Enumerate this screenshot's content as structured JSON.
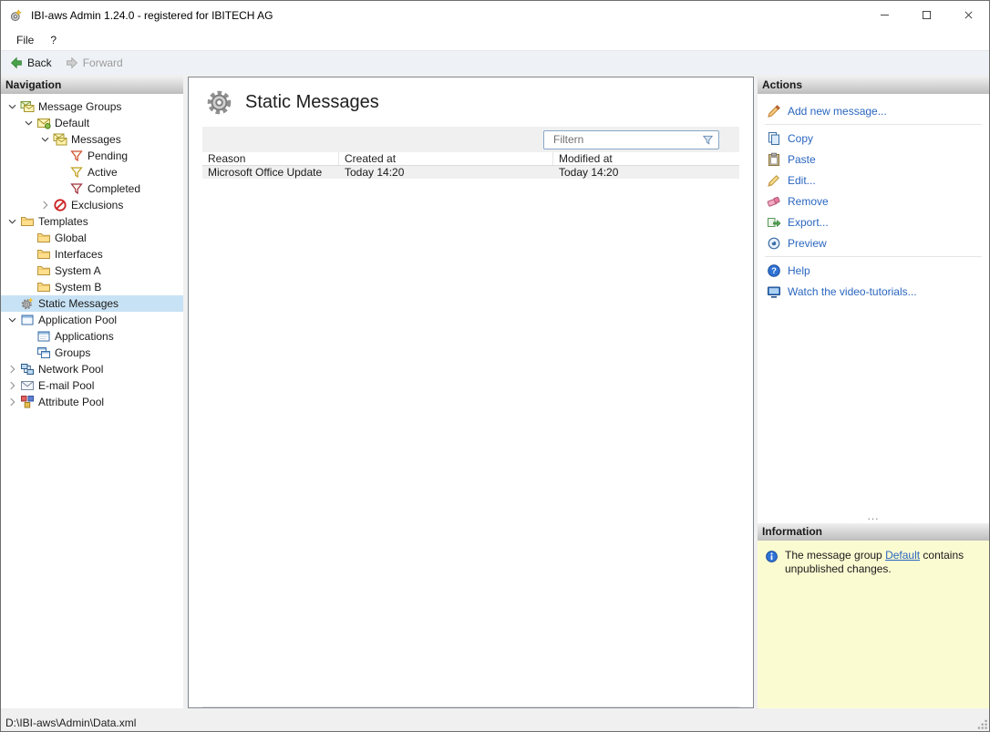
{
  "window": {
    "title": "IBI-aws Admin 1.24.0 - registered for IBITECH AG"
  },
  "menubar": {
    "items": [
      {
        "label": "File"
      },
      {
        "label": "?"
      }
    ]
  },
  "toolbar": {
    "back_label": "Back",
    "forward_label": "Forward"
  },
  "navigation": {
    "header": "Navigation",
    "items": [
      {
        "label": "Message Groups",
        "icon": "message-groups-icon",
        "depth": 0,
        "expand": "expanded",
        "selected": false
      },
      {
        "label": "Default",
        "icon": "message-group-icon",
        "depth": 1,
        "expand": "expanded",
        "selected": false
      },
      {
        "label": "Messages",
        "icon": "messages-icon",
        "depth": 2,
        "expand": "expanded",
        "selected": false
      },
      {
        "label": "Pending",
        "icon": "filter-pending-icon",
        "depth": 3,
        "expand": "none",
        "selected": false
      },
      {
        "label": "Active",
        "icon": "filter-active-icon",
        "depth": 3,
        "expand": "none",
        "selected": false
      },
      {
        "label": "Completed",
        "icon": "filter-completed-icon",
        "depth": 3,
        "expand": "none",
        "selected": false
      },
      {
        "label": "Exclusions",
        "icon": "exclusions-icon",
        "depth": 2,
        "expand": "collapsed",
        "selected": false
      },
      {
        "label": "Templates",
        "icon": "folder-icon",
        "depth": 0,
        "expand": "expanded",
        "selected": false
      },
      {
        "label": "Global",
        "icon": "folder-icon",
        "depth": 1,
        "expand": "none",
        "selected": false
      },
      {
        "label": "Interfaces",
        "icon": "folder-icon",
        "depth": 1,
        "expand": "none",
        "selected": false
      },
      {
        "label": "System A",
        "icon": "folder-icon",
        "depth": 1,
        "expand": "none",
        "selected": false
      },
      {
        "label": "System B",
        "icon": "folder-icon",
        "depth": 1,
        "expand": "none",
        "selected": false
      },
      {
        "label": "Static Messages",
        "icon": "static-messages-icon",
        "depth": 0,
        "expand": "none",
        "selected": true
      },
      {
        "label": "Application Pool",
        "icon": "application-pool-icon",
        "depth": 0,
        "expand": "expanded",
        "selected": false
      },
      {
        "label": "Applications",
        "icon": "applications-icon",
        "depth": 1,
        "expand": "none",
        "selected": false
      },
      {
        "label": "Groups",
        "icon": "groups-icon",
        "depth": 1,
        "expand": "none",
        "selected": false
      },
      {
        "label": "Network Pool",
        "icon": "network-pool-icon",
        "depth": 0,
        "expand": "collapsed",
        "selected": false
      },
      {
        "label": "E-mail Pool",
        "icon": "email-pool-icon",
        "depth": 0,
        "expand": "collapsed",
        "selected": false
      },
      {
        "label": "Attribute Pool",
        "icon": "attribute-pool-icon",
        "depth": 0,
        "expand": "collapsed",
        "selected": false
      }
    ]
  },
  "main": {
    "title": "Static Messages",
    "filter": {
      "placeholder": "Filtern"
    },
    "table": {
      "columns": [
        "Reason",
        "Created at",
        "Modified at"
      ],
      "rows": [
        [
          "Microsoft Office Update",
          "Today 14:20",
          "Today 14:20"
        ]
      ]
    }
  },
  "actions": {
    "header": "Actions",
    "splitter_dots": "...",
    "items": [
      {
        "label": "Add new message...",
        "icon": "add-message-icon",
        "group": 0
      },
      {
        "label": "Copy",
        "icon": "copy-icon",
        "group": 1
      },
      {
        "label": "Paste",
        "icon": "paste-icon",
        "group": 1
      },
      {
        "label": "Edit...",
        "icon": "edit-icon",
        "group": 1
      },
      {
        "label": "Remove",
        "icon": "remove-icon",
        "group": 1
      },
      {
        "label": "Export...",
        "icon": "export-icon",
        "group": 1
      },
      {
        "label": "Preview",
        "icon": "preview-icon",
        "group": 1
      },
      {
        "label": "Help",
        "icon": "help-icon",
        "group": 2
      },
      {
        "label": "Watch the video-tutorials...",
        "icon": "video-tutorials-icon",
        "group": 2
      }
    ]
  },
  "information": {
    "header": "Information",
    "message": {
      "before": "The message group ",
      "link": "Default",
      "after": " contains unpublished changes."
    }
  },
  "statusbar": {
    "path": "D:\\IBI-aws\\Admin\\Data.xml"
  },
  "colors": {
    "link": "#2a66c0",
    "selection": "#c8e2f5",
    "info_bg": "#fbfbd2",
    "header_gradient_top": "#efefef",
    "header_gradient_bottom": "#bdbdbd"
  }
}
